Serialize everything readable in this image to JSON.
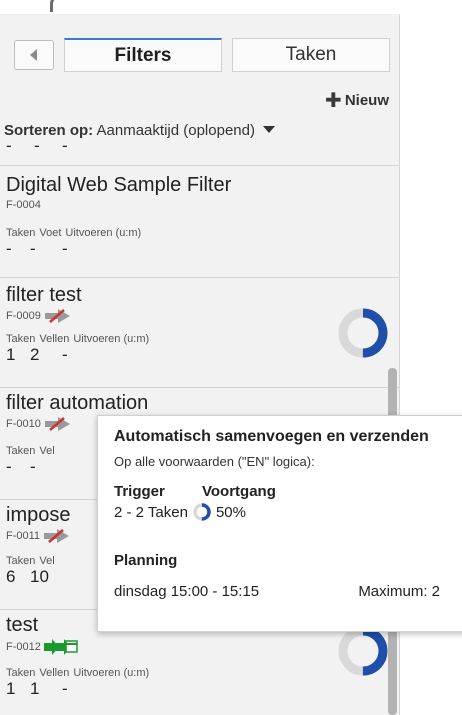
{
  "tabs": {
    "back_icon": "chevron-left-icon",
    "items": [
      {
        "label": "Filters",
        "active": true
      },
      {
        "label": "Taken",
        "active": false
      }
    ]
  },
  "toolbar": {
    "new_label": "Nieuw",
    "new_icon": "plus-icon"
  },
  "sort": {
    "label": "Sorteren op:",
    "value": "Aanmaaktijd (oplopend)"
  },
  "partial_row": {
    "values": [
      "-",
      "-",
      "-"
    ]
  },
  "filters": [
    {
      "name": "Digital Web Sample Filter",
      "id": "F-0004",
      "columns": [
        "Taken",
        "Voet",
        "Uitvoeren (u:m)"
      ],
      "values": [
        "-",
        "-",
        "-"
      ]
    },
    {
      "name": "filter test",
      "id": "F-0009",
      "status_icon": "disabled-arrow-icon",
      "columns": [
        "Taken",
        "Vellen",
        "Uitvoeren (u:m)"
      ],
      "values": [
        "1",
        "2",
        "-"
      ],
      "progress": 0.5
    },
    {
      "name": "filter automation",
      "id": "F-0010",
      "status_icon": "disabled-arrow-icon",
      "columns": [
        "Taken",
        "Vel"
      ],
      "values": [
        "-",
        "-"
      ]
    },
    {
      "name": "impose",
      "id": "F-0011",
      "status_icon": "disabled-arrow-icon",
      "columns": [
        "Taken",
        "Vel"
      ],
      "values": [
        "6",
        "10"
      ]
    },
    {
      "name": "test",
      "id": "F-0012",
      "status_icon": "scheduled-arrow-icon",
      "columns": [
        "Taken",
        "Vellen",
        "Uitvoeren (u:m)"
      ],
      "values": [
        "1",
        "1",
        "-"
      ],
      "progress": 0.5
    }
  ],
  "tooltip": {
    "title": "Automatisch samenvoegen en verzenden",
    "subtitle": "Op alle voorwaarden (\"EN\" logica):",
    "trigger_head": "Trigger",
    "progress_head": "Voortgang",
    "trigger_value": "2 - 2 Taken",
    "progress_value": "50%",
    "progress": 0.5,
    "planning_head": "Planning",
    "schedule": "dinsdag 15:00 - 15:15",
    "maximum": "Maximum: 2"
  },
  "colors": {
    "accent": "#1f4fa8",
    "ring_track": "#d9d9d9",
    "active_green": "#1a9a2e",
    "disabled_red": "#d0342c",
    "tab_accent": "#3a7bd5"
  }
}
